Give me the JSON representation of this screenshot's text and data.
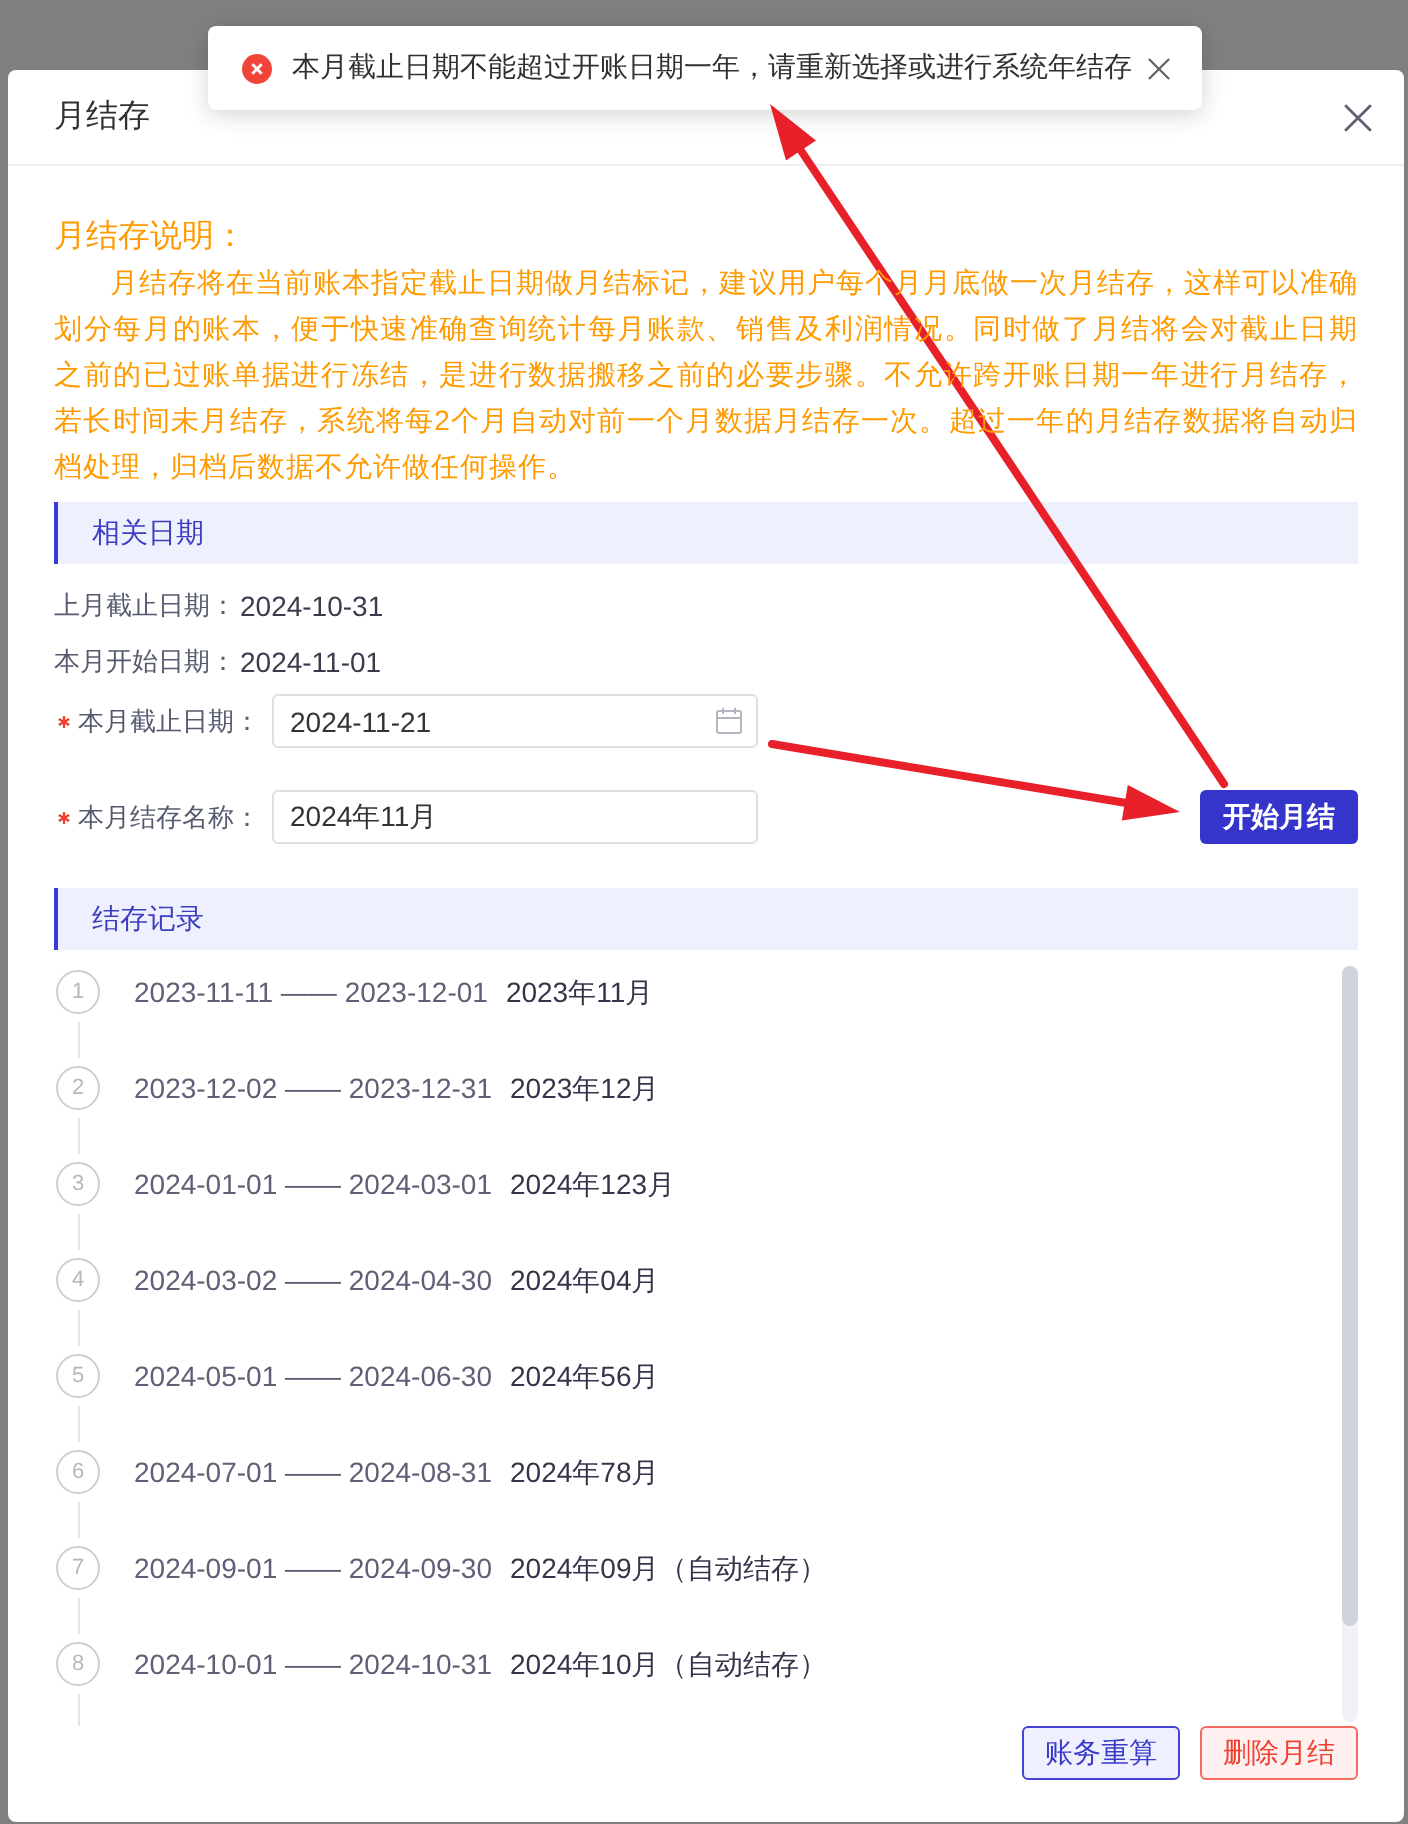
{
  "toast": {
    "kind": "error",
    "message": "本月截止日期不能超过开账日期一年，请重新选择或进行系统年结存"
  },
  "dialog": {
    "title": "月结存"
  },
  "notice": {
    "title": "月结存说明：",
    "body": "月结存将在当前账本指定截止日期做月结标记，建议用户每个月月底做一次月结存，这样可以准确划分每月的账本，便于快速准确查询统计每月账款、销售及利润情况。同时做了月结将会对截止日期之前的已过账单据进行冻结，是进行数据搬移之前的必要步骤。不允许跨开账日期一年进行月结存，若长时间未月结存，系统将每2个月自动对前一个月数据月结存一次。超过一年的月结存数据将自动归档处理，归档后数据不允许做任何操作。"
  },
  "date_section": {
    "title": "相关日期",
    "info": [
      {
        "label": "上月截止日期：",
        "value": "2024-10-31"
      },
      {
        "label": "本月开始日期：",
        "value": "2024-11-01"
      }
    ],
    "fields": [
      {
        "label": "本月截止日期：",
        "required": true,
        "kind": "date",
        "value": "2024-11-21"
      },
      {
        "label": "本月结存名称：",
        "required": true,
        "kind": "text",
        "value": "2024年11月"
      }
    ],
    "start_button": "开始月结"
  },
  "records_section": {
    "title": "结存记录",
    "records": [
      {
        "index": "1",
        "range": "2023-11-11 —— 2023-12-01",
        "name": "2023年11月"
      },
      {
        "index": "2",
        "range": "2023-12-02 —— 2023-12-31",
        "name": "2023年12月"
      },
      {
        "index": "3",
        "range": "2024-01-01 —— 2024-03-01",
        "name": "2024年123月"
      },
      {
        "index": "4",
        "range": "2024-03-02 —— 2024-04-30",
        "name": "2024年04月"
      },
      {
        "index": "5",
        "range": "2024-05-01 —— 2024-06-30",
        "name": "2024年56月"
      },
      {
        "index": "6",
        "range": "2024-07-01 —— 2024-08-31",
        "name": "2024年78月"
      },
      {
        "index": "7",
        "range": "2024-09-01 —— 2024-09-30",
        "name": "2024年09月（自动结存）"
      },
      {
        "index": "8",
        "range": "2024-10-01 —— 2024-10-31",
        "name": "2024年10月（自动结存）"
      }
    ]
  },
  "footer_buttons": [
    {
      "label": "账务重算",
      "kind": "primary"
    },
    {
      "label": "删除月结",
      "kind": "danger"
    }
  ]
}
